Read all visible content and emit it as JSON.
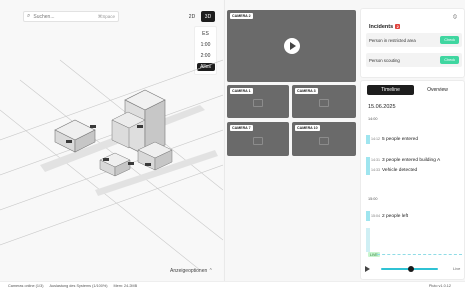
{
  "search": {
    "placeholder": "Suchen...",
    "shortcut": "⌘Space"
  },
  "view_toggle": {
    "opt2d": "2D",
    "opt3d": "3D",
    "selected": "3D"
  },
  "time_options": [
    "ES",
    "1:00",
    "2:00",
    "Alles"
  ],
  "time_selected": "Alles",
  "map_footer": {
    "label": "Anzeigeoptionen ⌃"
  },
  "cameras": {
    "main": "CAMERA 2",
    "c1": "CAMERA 1",
    "c3": "CAMERA 3",
    "c7": "CAMERA 7",
    "c10": "CAMERA 10"
  },
  "incidents": {
    "title": "Incidents",
    "count": "2",
    "items": [
      {
        "label": "Person in restricted area",
        "action": "Check"
      },
      {
        "label": "Person scouting",
        "action": "Check"
      }
    ]
  },
  "tabs": {
    "timeline": "Timeline",
    "overview": "Overview",
    "selected": "Timeline"
  },
  "timeline": {
    "date": "15.06.2025",
    "hour1": "14:00",
    "hour2": "15:00",
    "events": [
      {
        "time": "14:12",
        "text": "5 people entered"
      },
      {
        "time": "14:31",
        "text": "3 people entered building A"
      },
      {
        "time": "14:33",
        "text": "Vehicle detected"
      },
      {
        "time": "15:04",
        "text": "2 people left"
      }
    ],
    "live_tag": "LIVE",
    "live_label": "Live"
  },
  "status": {
    "cams": "Cameras online (1/3)",
    "load": "Auslastung des Systems (1/100%)",
    "mem": "Mem: 24.2MB",
    "version": "Pluto v1.0.12"
  },
  "colors": {
    "accent": "#3fd6a0",
    "timeline": "#2fc2d4",
    "alert": "#e0413b",
    "dark": "#1d1d1d"
  }
}
